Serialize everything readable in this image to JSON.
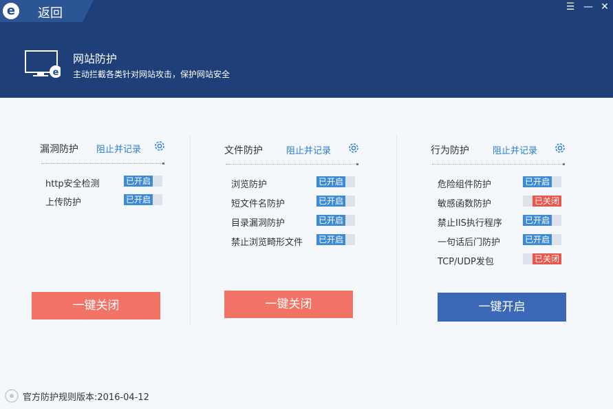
{
  "header": {
    "back_label": "返回",
    "logo_glyph": "e",
    "menu_glyph": "☰",
    "minimize_glyph": "—",
    "close_glyph": "✕",
    "title": "网站防护",
    "description": "主动拦截各类针对网站攻击，保护网站安全",
    "colors": {
      "bar": "#1f3f78",
      "tab": "#2c5596"
    }
  },
  "panels": [
    {
      "title": "漏洞防护",
      "link": "阻止并记录",
      "icon": "gear-icon",
      "items": [
        {
          "label": "http安全检测",
          "state_text": "已开启",
          "on": true
        },
        {
          "label": "上传防护",
          "state_text": "已开启",
          "on": true
        }
      ],
      "button": "一键关闭"
    },
    {
      "title": "文件防护",
      "link": "阻止并记录",
      "icon": "gear-icon",
      "items": [
        {
          "label": "浏览防护",
          "state_text": "已开启",
          "on": true
        },
        {
          "label": "短文件名防护",
          "state_text": "已开启",
          "on": true
        },
        {
          "label": "目录漏洞防护",
          "state_text": "已开启",
          "on": true
        },
        {
          "label": "禁止浏览畸形文件",
          "state_text": "已开启",
          "on": true
        }
      ],
      "button": "一键关闭"
    },
    {
      "title": "行为防护",
      "link": "阻止并记录",
      "icon": "gear-icon",
      "items": [
        {
          "label": "危险组件防护",
          "state_text": "已开启",
          "on": true
        },
        {
          "label": "敏感函数防护",
          "state_text": "已关闭",
          "on": false
        },
        {
          "label": "禁止IIS执行程序",
          "state_text": "已开启",
          "on": true
        },
        {
          "label": "一句话后门防护",
          "state_text": "已开启",
          "on": true
        },
        {
          "label": "TCP/UDP发包",
          "state_text": "已关闭",
          "on": false
        }
      ],
      "button": "一键开启"
    }
  ],
  "footer": {
    "text": "官方防护规则版本:2016-04-12"
  },
  "colors": {
    "on": "#3e8ad3",
    "off": "#e8574b",
    "btn_close": "#f27466",
    "btn_open": "#3b69b8",
    "link": "#2a7bd5"
  }
}
